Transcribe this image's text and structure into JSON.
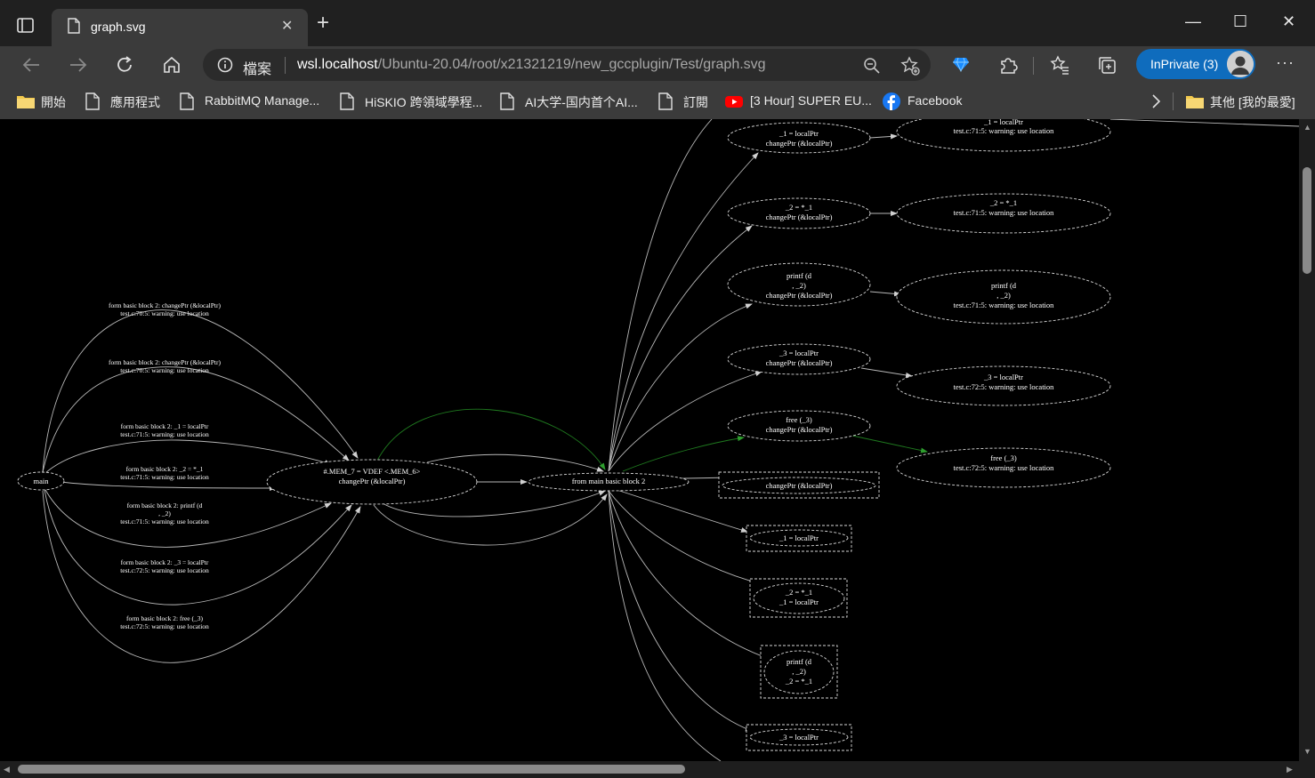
{
  "window": {
    "tab_title": "graph.svg",
    "tab_close": "✕",
    "new_tab": "+",
    "minimize": "—",
    "maximize": "☐",
    "close": "✕"
  },
  "address_bar": {
    "site_info_label": "檔案",
    "url_host": "wsl.localhost",
    "url_path": "/Ubuntu-20.04/root/x21321219/new_gccplugin/Test/graph.svg"
  },
  "profile": {
    "label": "InPrivate (3)"
  },
  "toolbar": {
    "more": "···"
  },
  "bookmarks": [
    {
      "label": "開始",
      "icon": "folder-icon"
    },
    {
      "label": "應用程式",
      "icon": "page-icon"
    },
    {
      "label": "RabbitMQ Manage...",
      "icon": "page-icon"
    },
    {
      "label": "HiSKIO 跨領域學程...",
      "icon": "page-icon"
    },
    {
      "label": "AI大学-国内首个AI...",
      "icon": "page-icon"
    },
    {
      "label": "訂閱",
      "icon": "page-icon"
    },
    {
      "label": "[3 Hour] SUPER EU...",
      "icon": "youtube-icon"
    },
    {
      "label": "Facebook",
      "icon": "facebook-icon"
    }
  ],
  "other_favorites": "其他 [我的最愛]",
  "graph": {
    "nodes": {
      "main": "main",
      "mem": [
        "#.MEM_7 = VDEF <.MEM_6>",
        "changePtr (&localPtr)"
      ],
      "bb2": "from main basic block 2",
      "r1": [
        "_1 = localPtr",
        "changePtr (&localPtr)"
      ],
      "r2": [
        "_2 = *_1",
        "changePtr (&localPtr)"
      ],
      "r3": [
        "printf (d",
        ", _2)",
        "changePtr (&localPtr)"
      ],
      "r4": [
        "_3 = localPtr",
        "changePtr (&localPtr)"
      ],
      "r5": [
        "free (_3)",
        "changePtr (&localPtr)"
      ],
      "f1": [
        "_1 = localPtr",
        "test.c:71:5: warning: use location"
      ],
      "f2": [
        "_2 = *_1",
        "test.c:71:5: warning: use location"
      ],
      "f3": [
        "printf (d",
        ", _2)",
        "test.c:71:5: warning: use location"
      ],
      "f4": [
        "_3 = localPtr",
        "test.c:72:5: warning: use location"
      ],
      "f5": [
        "free (_3)",
        "test.c:72:5: warning: use location"
      ],
      "b1": "changePtr (&localPtr)",
      "b2": "_1 = localPtr",
      "b3": [
        "_2 = *_1",
        "_1 = localPtr"
      ],
      "b4": [
        "printf (d",
        ", _2)",
        "_2 = *_1"
      ],
      "b5": "_3 = localPtr"
    },
    "edge_labels": [
      [
        "form basic block 2: changePtr (&localPtr)",
        "test.c:70:5: warning: use location"
      ],
      [
        "form basic block 2: changePtr (&localPtr)",
        "test.c:70:5: warning: use location"
      ],
      [
        "form basic block 2: _1 = localPtr",
        "test.c:71:5: warning: use location"
      ],
      [
        "form basic block 2: _2 = *_1",
        "test.c:71:5: warning: use location"
      ],
      [
        "form basic block 2: printf (d",
        ", _2)",
        "test.c:71:5: warning: use location"
      ],
      [
        "form basic block 2: _3 = localPtr",
        "test.c:72:5: warning: use location"
      ],
      [
        "form basic block 2: free (_3)",
        "test.c:72:5: warning: use location"
      ]
    ]
  }
}
